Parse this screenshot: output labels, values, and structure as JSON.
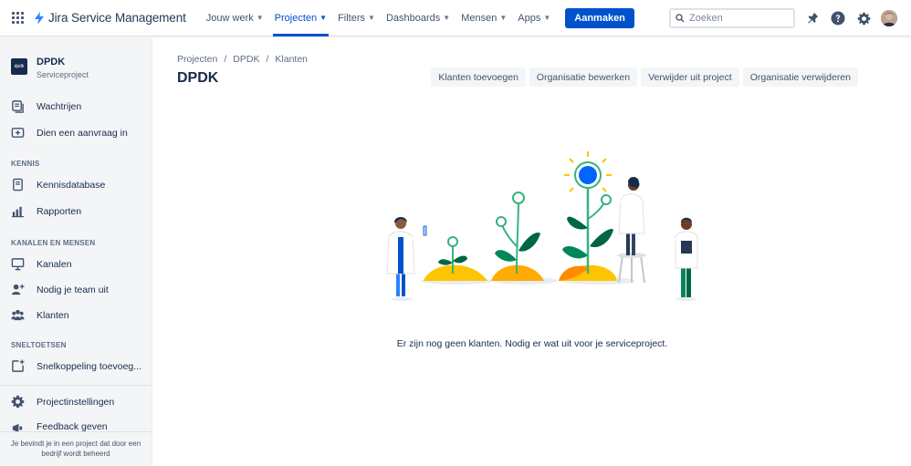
{
  "topnav": {
    "product": "Jira Service Management",
    "items": [
      {
        "label": "Jouw werk",
        "dropdown": true,
        "active": false
      },
      {
        "label": "Projecten",
        "dropdown": true,
        "active": true
      },
      {
        "label": "Filters",
        "dropdown": true,
        "active": false
      },
      {
        "label": "Dashboards",
        "dropdown": true,
        "active": false
      },
      {
        "label": "Mensen",
        "dropdown": true,
        "active": false
      },
      {
        "label": "Apps",
        "dropdown": true,
        "active": false
      }
    ],
    "create_label": "Aanmaken",
    "search_placeholder": "Zoeken",
    "icons": [
      "notifications-icon",
      "help-icon",
      "settings-icon"
    ]
  },
  "sidebar": {
    "project_logo_text": "dpdk",
    "project_name": "DPDK",
    "project_type": "Serviceproject",
    "items_top": [
      {
        "label": "Wachtrijen",
        "icon": "queues-icon"
      },
      {
        "label": "Dien een aanvraag in",
        "icon": "raise-request-icon"
      }
    ],
    "section_kennis": "KENNIS",
    "items_kennis": [
      {
        "label": "Kennisdatabase",
        "icon": "knowledge-base-icon"
      },
      {
        "label": "Rapporten",
        "icon": "reports-icon"
      }
    ],
    "section_kanalen": "KANALEN EN MENSEN",
    "items_kanalen": [
      {
        "label": "Kanalen",
        "icon": "channels-icon"
      },
      {
        "label": "Nodig je team uit",
        "icon": "invite-team-icon"
      },
      {
        "label": "Klanten",
        "icon": "customers-icon"
      }
    ],
    "section_sneltoetsen": "SNELTOETSEN",
    "items_sneltoetsen": [
      {
        "label": "Snelkoppeling toevoeg...",
        "icon": "add-shortcut-icon"
      }
    ],
    "items_bottom": [
      {
        "label": "Projectinstellingen",
        "icon": "settings-icon"
      },
      {
        "label": "Feedback geven",
        "icon": "feedback-icon"
      }
    ],
    "footer": "Je bevindt je in een project dat door een bedrijf wordt beheerd"
  },
  "main": {
    "breadcrumb": [
      "Projecten",
      "DPDK",
      "Klanten"
    ],
    "title": "DPDK",
    "actions": [
      "Klanten toevoegen",
      "Organisatie bewerken",
      "Verwijder uit project",
      "Organisatie verwijderen"
    ],
    "empty_message": "Er zijn nog geen klanten. Nodig er wat uit voor je serviceproject."
  },
  "colors": {
    "primary": "#0052CC",
    "nav_text": "#42526E",
    "sidebar_bg": "#F4F5F7",
    "button_bg": "#F4F5F7"
  }
}
